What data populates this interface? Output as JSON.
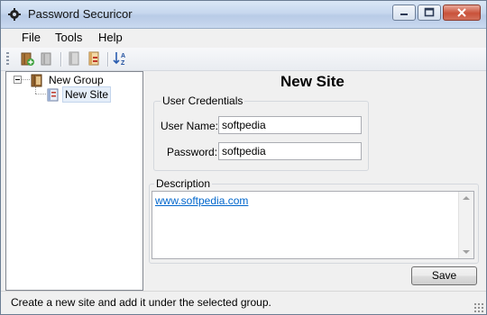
{
  "window": {
    "title": "Password Securicor"
  },
  "menu": {
    "items": [
      "File",
      "Tools",
      "Help"
    ]
  },
  "toolbar": {
    "buttons": [
      {
        "icon": "add-group-icon"
      },
      {
        "icon": "delete-icon"
      },
      {
        "icon": "add-site-icon"
      },
      {
        "icon": "edit-site-icon"
      },
      {
        "icon": "sort-az-icon"
      }
    ]
  },
  "tree": {
    "group_label": "New Group",
    "site_label": "New Site"
  },
  "site": {
    "title": "New Site",
    "credentials_label": "User Credentials",
    "username_label": "User Name:",
    "username_value": "softpedia",
    "password_label": "Password:",
    "password_value": "softpedia",
    "description_label": "Description",
    "description_value": "www.softpedia.com",
    "save_label": "Save"
  },
  "status": {
    "text": "Create a new site and add it under the selected group."
  }
}
